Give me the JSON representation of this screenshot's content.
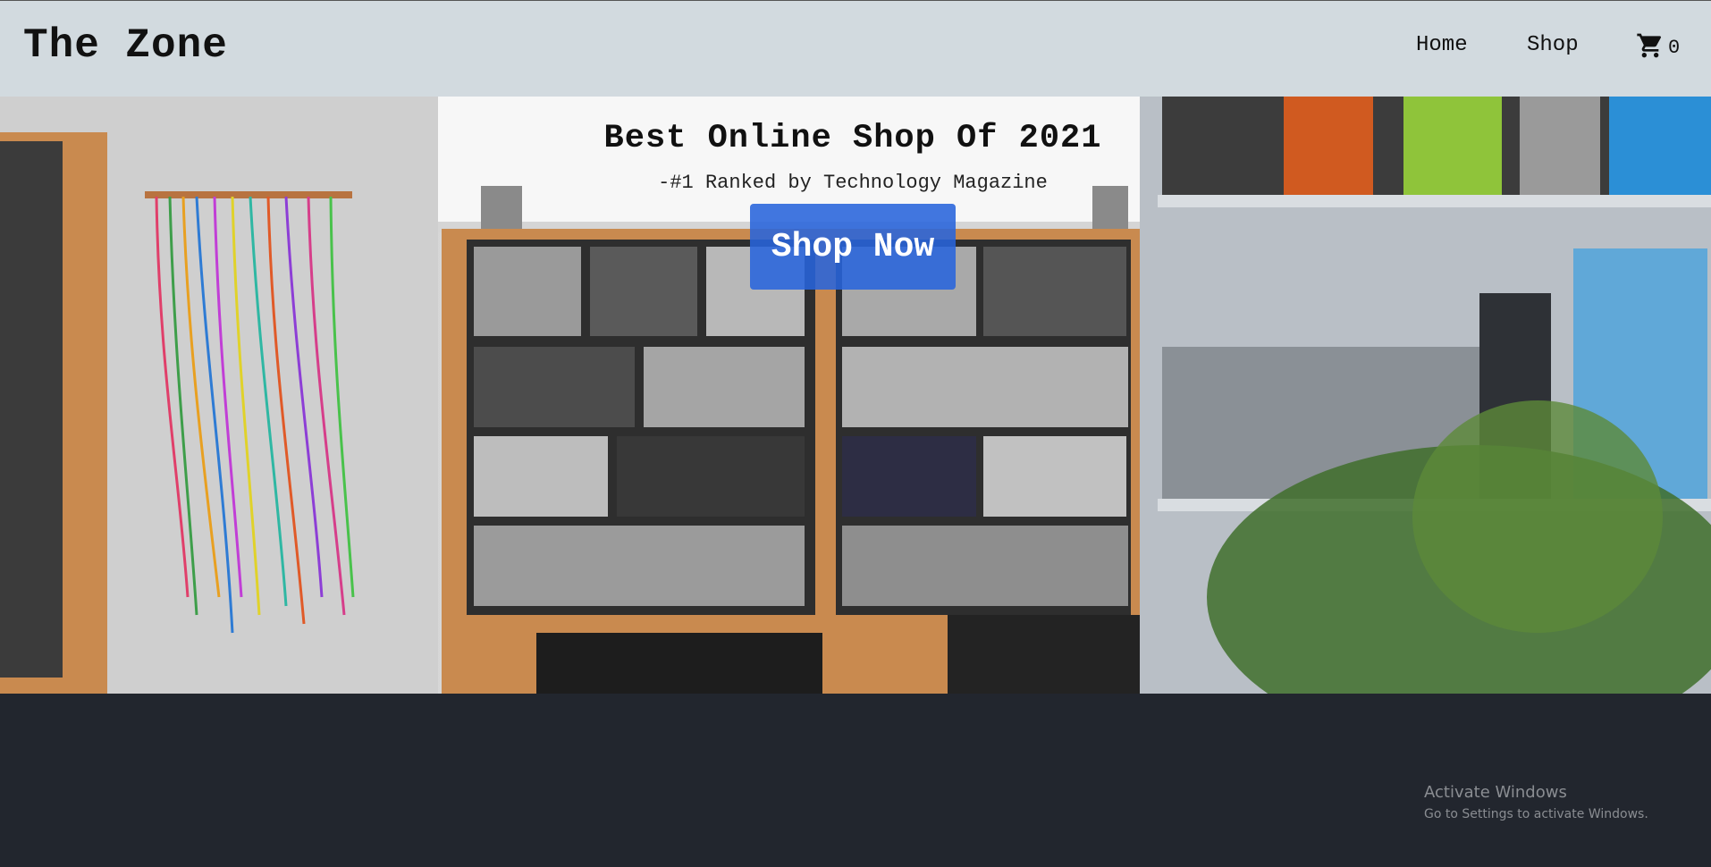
{
  "navbar": {
    "brand": "The Zone",
    "links": [
      "Home",
      "Shop"
    ],
    "cart_icon": "cart-icon",
    "cart_count": "0"
  },
  "hero": {
    "headline": "Best Online Shop Of 2021",
    "subtitle": "-#1 Ranked by Technology Magazine",
    "cta_label": "Shop Now"
  },
  "watermark": {
    "title": "Activate Windows",
    "subtitle": "Go to Settings to activate Windows."
  },
  "colors": {
    "navbar_bg": "#d2dadf",
    "footer_bg": "#22262e",
    "cta_bg": "#2864dc"
  }
}
